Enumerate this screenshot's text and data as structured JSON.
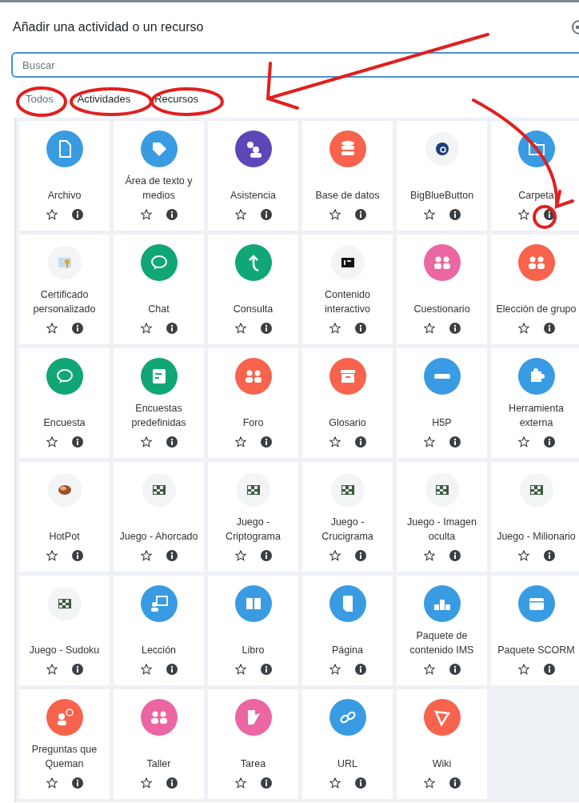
{
  "dialog": {
    "title": "Añadir una actividad o un recurso"
  },
  "search": {
    "placeholder": "Buscar"
  },
  "tabs": [
    {
      "label": "Todos",
      "selected": true
    },
    {
      "label": "Actividades",
      "selected": false
    },
    {
      "label": "Recursos",
      "selected": false
    }
  ],
  "items": [
    {
      "label": "Archivo",
      "kind": "circle",
      "color": "#399be2"
    },
    {
      "label": "Área de texto y medios",
      "kind": "circle",
      "color": "#399be2"
    },
    {
      "label": "Asistencia",
      "kind": "circle",
      "color": "#5d46b8"
    },
    {
      "label": "Base de datos",
      "kind": "circle",
      "color": "#f7634d"
    },
    {
      "label": "BigBlueButton",
      "kind": "plugin"
    },
    {
      "label": "Carpeta",
      "kind": "circle",
      "color": "#399be2"
    },
    {
      "label": "Certificado personalizado",
      "kind": "plugin"
    },
    {
      "label": "Chat",
      "kind": "circle",
      "color": "#11a676"
    },
    {
      "label": "Consulta",
      "kind": "circle",
      "color": "#11a676"
    },
    {
      "label": "Contenido interactivo",
      "kind": "plugin"
    },
    {
      "label": "Cuestionario",
      "kind": "circle",
      "color": "#eb66a2"
    },
    {
      "label": "Elección de grupo",
      "kind": "circle",
      "color": "#f7634d"
    },
    {
      "label": "Encuesta",
      "kind": "circle",
      "color": "#11a676"
    },
    {
      "label": "Encuestas predefinidas",
      "kind": "circle",
      "color": "#11a676"
    },
    {
      "label": "Foro",
      "kind": "circle",
      "color": "#f7634d"
    },
    {
      "label": "Glosario",
      "kind": "circle",
      "color": "#f7634d"
    },
    {
      "label": "H5P",
      "kind": "circle",
      "color": "#399be2"
    },
    {
      "label": "Herramienta externa",
      "kind": "circle",
      "color": "#399be2"
    },
    {
      "label": "HotPot",
      "kind": "plugin"
    },
    {
      "label": "Juego - Ahorcado",
      "kind": "plugin"
    },
    {
      "label": "Juego - Criptograma",
      "kind": "plugin"
    },
    {
      "label": "Juego - Crucigrama",
      "kind": "plugin"
    },
    {
      "label": "Juego - Imagen oculta",
      "kind": "plugin"
    },
    {
      "label": "Juego - Milionario",
      "kind": "plugin"
    },
    {
      "label": "Juego - Sudoku",
      "kind": "plugin"
    },
    {
      "label": "Lección",
      "kind": "circle",
      "color": "#399be2"
    },
    {
      "label": "Libro",
      "kind": "circle",
      "color": "#399be2"
    },
    {
      "label": "Página",
      "kind": "circle",
      "color": "#399be2"
    },
    {
      "label": "Paquete de contenido IMS",
      "kind": "circle",
      "color": "#399be2"
    },
    {
      "label": "Paquete SCORM",
      "kind": "circle",
      "color": "#399be2"
    },
    {
      "label": "Preguntas que Queman",
      "kind": "circle",
      "color": "#f7634d"
    },
    {
      "label": "Taller",
      "kind": "circle",
      "color": "#eb66a2"
    },
    {
      "label": "Tarea",
      "kind": "circle",
      "color": "#eb66a2"
    },
    {
      "label": "URL",
      "kind": "circle",
      "color": "#399be2"
    },
    {
      "label": "Wiki",
      "kind": "circle",
      "color": "#f7634d"
    }
  ]
}
